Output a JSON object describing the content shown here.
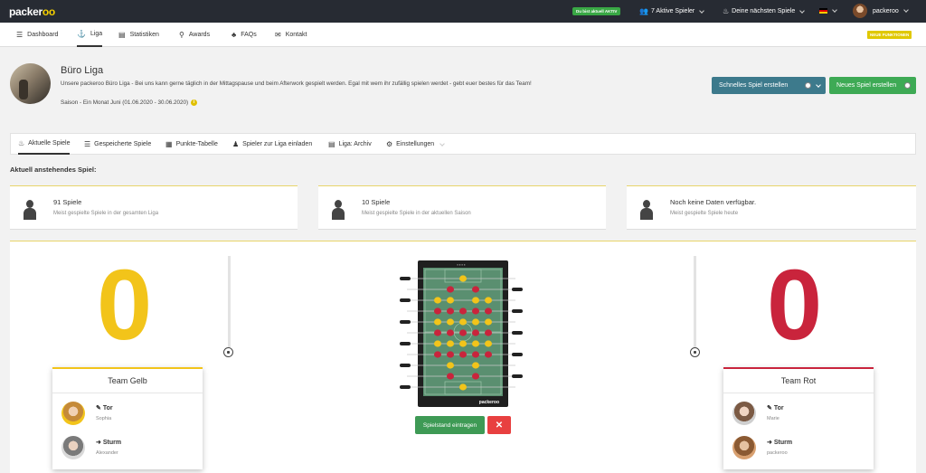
{
  "topbar": {
    "logo_main": "packer",
    "logo_accent": "oo",
    "status_badge": "Du bist aktuell AKTIV",
    "active_players": "7 Aktive Spieler",
    "next_games": "Deine nächsten Spiele",
    "username": "packeroo"
  },
  "nav": {
    "items": [
      {
        "label": "Dashboard",
        "icon": "foosball-icon"
      },
      {
        "label": "Liga",
        "icon": "trophy-icon"
      },
      {
        "label": "Statistiken",
        "icon": "chart-icon"
      },
      {
        "label": "Awards",
        "icon": "award-icon"
      },
      {
        "label": "FAQs",
        "icon": "faq-icon"
      },
      {
        "label": "Kontakt",
        "icon": "chat-icon"
      }
    ],
    "new_features": "NEUE FUNKTIONEN"
  },
  "league": {
    "title": "Büro Liga",
    "description": "Unsere packeroo Büro Liga - Bei uns kann gerne täglich in der Mittagspause und beim Afterwork gespielt werden. Egal mit wem ihr zufällig spielen werdet - gebt euer bestes für das Team!",
    "season": "Saison - Ein Monat Juni (01.06.2020 - 30.06.2020)",
    "info_glyph": "i",
    "quick_game": "Schnelles Spiel erstellen",
    "new_game": "Neues Spiel erstellen"
  },
  "tabs": [
    {
      "label": "Aktuelle Spiele",
      "icon": "flame-icon"
    },
    {
      "label": "Gespeicherte Spiele",
      "icon": "list-icon"
    },
    {
      "label": "Punkte-Tabelle",
      "icon": "table-icon"
    },
    {
      "label": "Spieler zur Liga einladen",
      "icon": "add-user-icon"
    },
    {
      "label": "Liga: Archiv",
      "icon": "archive-icon"
    },
    {
      "label": "Einstellungen",
      "icon": "gear-icon"
    }
  ],
  "section_title": "Aktuell anstehendes Spiel:",
  "stats": [
    {
      "value": "91 Spiele",
      "label": "Meist gespielte Spiele in der gesamten Liga"
    },
    {
      "value": "10 Spiele",
      "label": "Meist gespielte Spiele in der aktuellen Saison"
    },
    {
      "value": "Noch keine Daten verfügbar.",
      "label": "Meist gespielte Spiele heute"
    }
  ],
  "game": {
    "score_yellow": "0",
    "score_red": "0",
    "team_yellow": {
      "name": "Team Gelb",
      "color": "#f2c41a",
      "players": [
        {
          "role": "Tor",
          "name": "Sophia"
        },
        {
          "role": "Sturm",
          "name": "Alexander"
        }
      ]
    },
    "team_red": {
      "name": "Team Rot",
      "color": "#c9243c",
      "players": [
        {
          "role": "Tor",
          "name": "Marie"
        },
        {
          "role": "Sturm",
          "name": "packeroo"
        }
      ]
    },
    "enter_score": "Spielstand eintragen",
    "cancel_glyph": "✕",
    "table_brand": "packeroo"
  }
}
